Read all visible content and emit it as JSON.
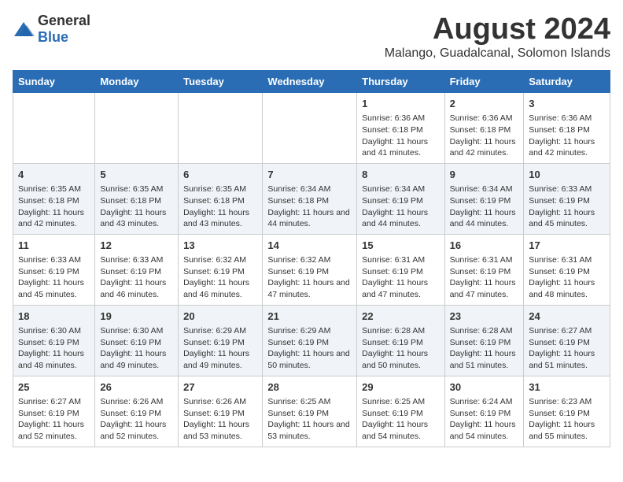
{
  "logo": {
    "text_general": "General",
    "text_blue": "Blue"
  },
  "title": "August 2024",
  "subtitle": "Malango, Guadalcanal, Solomon Islands",
  "days_of_week": [
    "Sunday",
    "Monday",
    "Tuesday",
    "Wednesday",
    "Thursday",
    "Friday",
    "Saturday"
  ],
  "weeks": [
    [
      {
        "day": "",
        "info": ""
      },
      {
        "day": "",
        "info": ""
      },
      {
        "day": "",
        "info": ""
      },
      {
        "day": "",
        "info": ""
      },
      {
        "day": "1",
        "sunrise": "6:36 AM",
        "sunset": "6:18 PM",
        "daylight": "11 hours and 41 minutes."
      },
      {
        "day": "2",
        "sunrise": "6:36 AM",
        "sunset": "6:18 PM",
        "daylight": "11 hours and 42 minutes."
      },
      {
        "day": "3",
        "sunrise": "6:36 AM",
        "sunset": "6:18 PM",
        "daylight": "11 hours and 42 minutes."
      }
    ],
    [
      {
        "day": "4",
        "sunrise": "6:35 AM",
        "sunset": "6:18 PM",
        "daylight": "11 hours and 42 minutes."
      },
      {
        "day": "5",
        "sunrise": "6:35 AM",
        "sunset": "6:18 PM",
        "daylight": "11 hours and 43 minutes."
      },
      {
        "day": "6",
        "sunrise": "6:35 AM",
        "sunset": "6:18 PM",
        "daylight": "11 hours and 43 minutes."
      },
      {
        "day": "7",
        "sunrise": "6:34 AM",
        "sunset": "6:18 PM",
        "daylight": "11 hours and 44 minutes."
      },
      {
        "day": "8",
        "sunrise": "6:34 AM",
        "sunset": "6:19 PM",
        "daylight": "11 hours and 44 minutes."
      },
      {
        "day": "9",
        "sunrise": "6:34 AM",
        "sunset": "6:19 PM",
        "daylight": "11 hours and 44 minutes."
      },
      {
        "day": "10",
        "sunrise": "6:33 AM",
        "sunset": "6:19 PM",
        "daylight": "11 hours and 45 minutes."
      }
    ],
    [
      {
        "day": "11",
        "sunrise": "6:33 AM",
        "sunset": "6:19 PM",
        "daylight": "11 hours and 45 minutes."
      },
      {
        "day": "12",
        "sunrise": "6:33 AM",
        "sunset": "6:19 PM",
        "daylight": "11 hours and 46 minutes."
      },
      {
        "day": "13",
        "sunrise": "6:32 AM",
        "sunset": "6:19 PM",
        "daylight": "11 hours and 46 minutes."
      },
      {
        "day": "14",
        "sunrise": "6:32 AM",
        "sunset": "6:19 PM",
        "daylight": "11 hours and 47 minutes."
      },
      {
        "day": "15",
        "sunrise": "6:31 AM",
        "sunset": "6:19 PM",
        "daylight": "11 hours and 47 minutes."
      },
      {
        "day": "16",
        "sunrise": "6:31 AM",
        "sunset": "6:19 PM",
        "daylight": "11 hours and 47 minutes."
      },
      {
        "day": "17",
        "sunrise": "6:31 AM",
        "sunset": "6:19 PM",
        "daylight": "11 hours and 48 minutes."
      }
    ],
    [
      {
        "day": "18",
        "sunrise": "6:30 AM",
        "sunset": "6:19 PM",
        "daylight": "11 hours and 48 minutes."
      },
      {
        "day": "19",
        "sunrise": "6:30 AM",
        "sunset": "6:19 PM",
        "daylight": "11 hours and 49 minutes."
      },
      {
        "day": "20",
        "sunrise": "6:29 AM",
        "sunset": "6:19 PM",
        "daylight": "11 hours and 49 minutes."
      },
      {
        "day": "21",
        "sunrise": "6:29 AM",
        "sunset": "6:19 PM",
        "daylight": "11 hours and 50 minutes."
      },
      {
        "day": "22",
        "sunrise": "6:28 AM",
        "sunset": "6:19 PM",
        "daylight": "11 hours and 50 minutes."
      },
      {
        "day": "23",
        "sunrise": "6:28 AM",
        "sunset": "6:19 PM",
        "daylight": "11 hours and 51 minutes."
      },
      {
        "day": "24",
        "sunrise": "6:27 AM",
        "sunset": "6:19 PM",
        "daylight": "11 hours and 51 minutes."
      }
    ],
    [
      {
        "day": "25",
        "sunrise": "6:27 AM",
        "sunset": "6:19 PM",
        "daylight": "11 hours and 52 minutes."
      },
      {
        "day": "26",
        "sunrise": "6:26 AM",
        "sunset": "6:19 PM",
        "daylight": "11 hours and 52 minutes."
      },
      {
        "day": "27",
        "sunrise": "6:26 AM",
        "sunset": "6:19 PM",
        "daylight": "11 hours and 53 minutes."
      },
      {
        "day": "28",
        "sunrise": "6:25 AM",
        "sunset": "6:19 PM",
        "daylight": "11 hours and 53 minutes."
      },
      {
        "day": "29",
        "sunrise": "6:25 AM",
        "sunset": "6:19 PM",
        "daylight": "11 hours and 54 minutes."
      },
      {
        "day": "30",
        "sunrise": "6:24 AM",
        "sunset": "6:19 PM",
        "daylight": "11 hours and 54 minutes."
      },
      {
        "day": "31",
        "sunrise": "6:23 AM",
        "sunset": "6:19 PM",
        "daylight": "11 hours and 55 minutes."
      }
    ]
  ],
  "labels": {
    "sunrise": "Sunrise:",
    "sunset": "Sunset:",
    "daylight": "Daylight:"
  }
}
